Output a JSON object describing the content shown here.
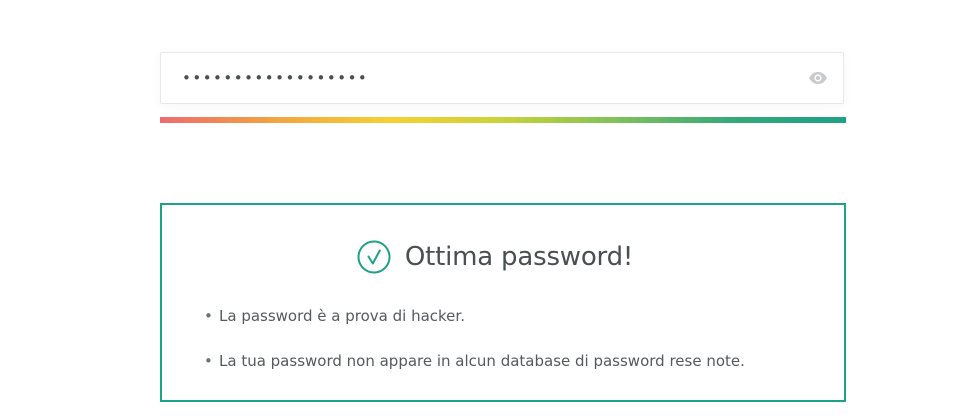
{
  "password_field": {
    "value": "••••••••••••••••••",
    "reveal_icon": "eye-icon"
  },
  "strength_meter": {
    "level": 1.0,
    "gradient_colors": [
      "#ef6b6d",
      "#f2a341",
      "#f6d132",
      "#c9d33a",
      "#7fc15a",
      "#35a97a",
      "#1fa086"
    ]
  },
  "result": {
    "icon": "check-circle-icon",
    "title": "Ottima password!",
    "accent_color": "#1fa089",
    "items": [
      {
        "bullet": "•",
        "text": "La password è a prova di hacker."
      },
      {
        "bullet": "•",
        "text": "La tua password non appare in alcun database di password rese note."
      }
    ]
  }
}
